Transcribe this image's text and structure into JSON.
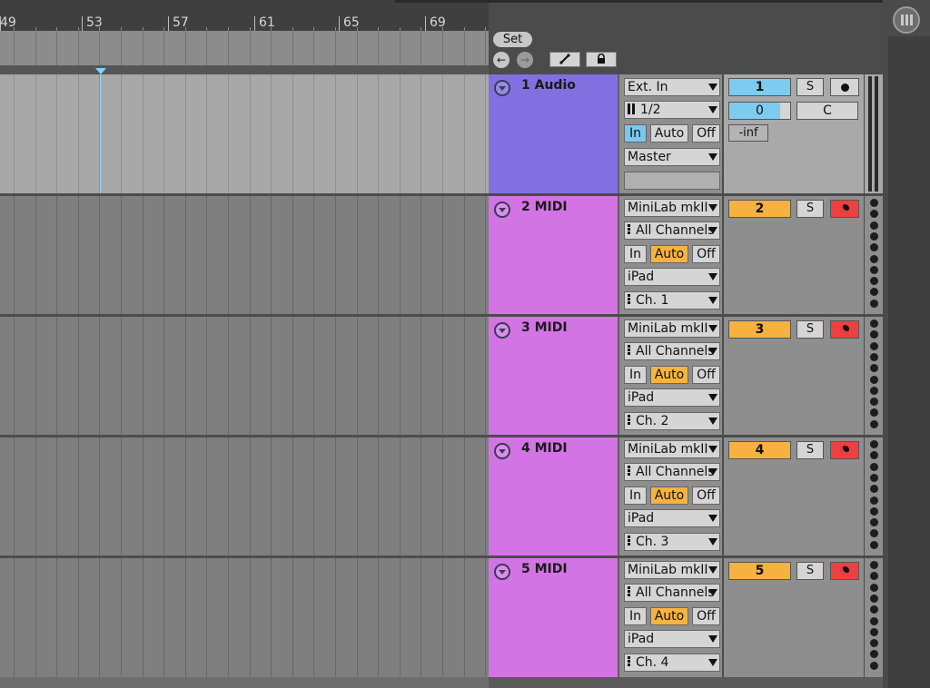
{
  "ruler": {
    "bars": [
      {
        "label": "49"
      },
      {
        "label": "53"
      },
      {
        "label": "57"
      },
      {
        "label": "61"
      },
      {
        "label": "65"
      },
      {
        "label": "69"
      }
    ]
  },
  "controls": {
    "set_label": "Set",
    "back_glyph": "←",
    "forward_glyph": "→",
    "draw_icon": "draw-mode-icon",
    "lock_icon": "lock-icon"
  },
  "tracks": [
    {
      "type": "audio",
      "name": "1 Audio",
      "input_type": "Ext. In",
      "input_channel": "1/2",
      "monitor": {
        "in": "In",
        "auto": "Auto",
        "off": "Off",
        "active": "in"
      },
      "output_type": "Master",
      "output_channel": "",
      "number": "1",
      "solo": "S",
      "volume": "0",
      "pan": "C",
      "peak": "-inf"
    },
    {
      "type": "midi",
      "name": "2 MIDI",
      "input_type": "MiniLab mkII",
      "input_channel": "All Channels",
      "monitor": {
        "in": "In",
        "auto": "Auto",
        "off": "Off",
        "active": "auto"
      },
      "output_type": "iPad",
      "output_channel": "Ch. 1",
      "number": "2",
      "solo": "S"
    },
    {
      "type": "midi",
      "name": "3 MIDI",
      "input_type": "MiniLab mkII",
      "input_channel": "All Channels",
      "monitor": {
        "in": "In",
        "auto": "Auto",
        "off": "Off",
        "active": "auto"
      },
      "output_type": "iPad",
      "output_channel": "Ch. 2",
      "number": "3",
      "solo": "S"
    },
    {
      "type": "midi",
      "name": "4 MIDI",
      "input_type": "MiniLab mkII",
      "input_channel": "All Channels",
      "monitor": {
        "in": "In",
        "auto": "Auto",
        "off": "Off",
        "active": "auto"
      },
      "output_type": "iPad",
      "output_channel": "Ch. 3",
      "number": "4",
      "solo": "S"
    },
    {
      "type": "midi",
      "name": "5 MIDI",
      "input_type": "MiniLab mkII",
      "input_channel": "All Channels",
      "monitor": {
        "in": "In",
        "auto": "Auto",
        "off": "Off",
        "active": "auto"
      },
      "output_type": "iPad",
      "output_channel": "Ch. 4",
      "number": "5",
      "solo": "S"
    }
  ],
  "colors": {
    "audio_track": "#8370e0",
    "midi_track": "#d374e4",
    "selected_blue": "#7ecbf0",
    "track_orange": "#f6b140",
    "arm_red": "#ee4040"
  }
}
